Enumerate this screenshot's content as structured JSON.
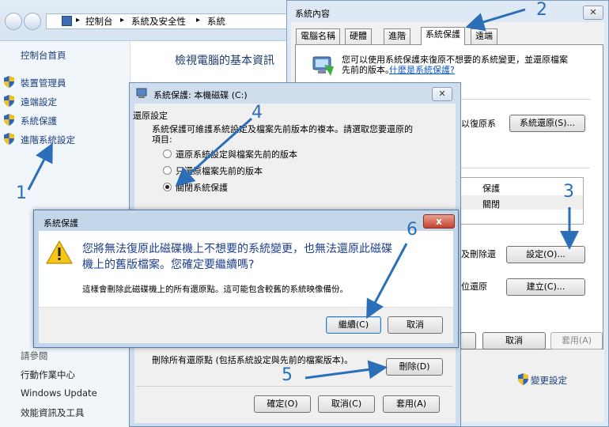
{
  "explorer": {
    "breadcrumb": [
      "控制台",
      "系統及安全性",
      "系統"
    ],
    "left_title": "控制台首頁",
    "left_items": [
      "裝置管理員",
      "遠端設定",
      "系統保護",
      "進階系統設定"
    ],
    "see_also": "請參閱",
    "see_also_items": [
      "行動作業中心",
      "Windows Update",
      "效能資訊及工具"
    ],
    "main_title": "檢視電腦的基本資訊"
  },
  "sysprop": {
    "title": "系統內容",
    "tabs": [
      "電腦名稱",
      "硬體",
      "進階",
      "系統保護",
      "遠端"
    ],
    "info_text_1": "您可以使用系統保護來復原不想要的系統變更，並還原檔案",
    "info_text_2": "先前的版本。",
    "info_link": "什麼是系統保護?",
    "restore_text": "以復原系",
    "restore_btn": "系統還原(S)...",
    "col_protect": "保護",
    "row_value": "關閉",
    "config_text": "及刪除還",
    "config_btn": "設定(O)...",
    "create_text": "位還原",
    "create_btn": "建立(C)...",
    "cancel_btn": "取消",
    "apply_btn": "套用(A)",
    "change_settings": "變更設定"
  },
  "restore": {
    "title": "系統保護: 本機磁碟 (C:)",
    "section": "還原設定",
    "desc_1": "系統保護可維護系統設定及檔案先前版本的複本。請選取您要還原的",
    "desc_2": "項目:",
    "options": [
      "還原系統設定與檔案先前的版本",
      "只還原檔案先前的版本",
      "關閉系統保護"
    ],
    "delete_text": "刪除所有還原點 (包括系統設定與先前的檔案版本)。",
    "delete_btn": "刪除(D)",
    "ok_btn": "確定(O)",
    "cancel_btn": "取消(C)",
    "apply_btn": "套用(A)"
  },
  "confirm": {
    "title": "系統保護",
    "message_1": "您將無法復原此磁碟機上不想要的系統變更，也無法還原此磁碟",
    "message_2": "機上的舊版檔案。您確定要繼續嗎?",
    "sub": "這樣會刪除此磁碟機上的所有還原點。這可能包含較舊的系統映像備份。",
    "continue_btn": "繼續(C)",
    "cancel_btn": "取消",
    "close": "x"
  },
  "annotations": [
    "1",
    "2",
    "3",
    "4",
    "5",
    "6"
  ],
  "colors": {
    "accent": "#2a6fb8",
    "link": "#1a3e7a",
    "title_bar": "#dfe9f5"
  }
}
